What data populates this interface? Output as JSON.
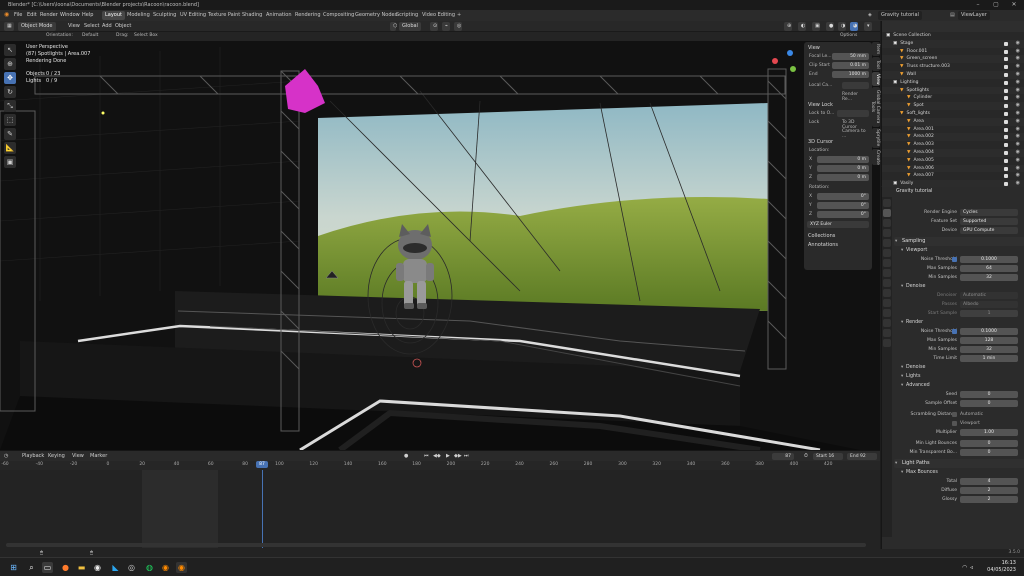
{
  "window": {
    "title": "Blender* [C:\\Users\\loona\\Documents\\Blender projects\\Racoon\\racoon.blend]"
  },
  "menu": {
    "items": [
      "File",
      "Edit",
      "Render",
      "Window",
      "Help"
    ],
    "workspaces": [
      "Layout",
      "Modeling",
      "Sculpting",
      "UV Editing",
      "Texture Paint",
      "Shading",
      "Animation",
      "Rendering",
      "Compositing",
      "Geometry Nodes",
      "Scripting",
      "Video Editing"
    ],
    "active_workspace": "Layout",
    "scene": "Gravity tutorial",
    "view_layer": "ViewLayer"
  },
  "viewport_header": {
    "mode": "Object Mode",
    "menus": [
      "View",
      "Select",
      "Add",
      "Object"
    ],
    "transform": "Global",
    "orientation_label": "Orientation:",
    "orientation_value": "Default",
    "drag_label": "Drag:",
    "drag_value": "Select Box",
    "options": "Options"
  },
  "viewport_overlay": {
    "perspective": "User Perspective",
    "collection": "(87) Spotlights | Area.007",
    "status": "Rendering Done",
    "objects_label": "Objects",
    "objects_value": "0 / 23",
    "lights_label": "Lights",
    "lights_value": "0 / 9"
  },
  "npanel": {
    "view_header": "View",
    "focal_label": "Focal Le...",
    "focal_value": "50 mm",
    "clip_start_label": "Clip Start",
    "clip_start_value": "0.01 m",
    "clip_end_label": "End",
    "clip_end_value": "1000 m",
    "local_camera_label": "Local Ca...",
    "render_region": "Render Re...",
    "view_lock_header": "View Lock",
    "lock_to_label": "Lock to O...",
    "lock_label": "Lock",
    "to_3d_cursor": "To 3D Cursor",
    "camera_to": "Camera to ...",
    "cursor_header": "3D Cursor",
    "location_label": "Location:",
    "loc_x": "0 m",
    "loc_y": "0 m",
    "loc_z": "0 m",
    "rotation_label": "Rotation:",
    "rot_x": "0°",
    "rot_y": "0°",
    "rot_z": "0°",
    "rotation_mode": "XYZ Euler",
    "collections": "Collections",
    "annotations": "Annotations",
    "axis_x": "X",
    "axis_y": "Y",
    "axis_z": "Z",
    "tabs": [
      "Item",
      "Tool",
      "View",
      "Global Camera Tools",
      "Sprytile",
      "Create"
    ]
  },
  "outliner": {
    "rows": [
      {
        "label": "Scene Collection",
        "indent": 0
      },
      {
        "label": "Stage",
        "indent": 1
      },
      {
        "label": "Floor.001",
        "indent": 2
      },
      {
        "label": "Green_screen",
        "indent": 2
      },
      {
        "label": "Truss structure.003",
        "indent": 2
      },
      {
        "label": "Wall",
        "indent": 2
      },
      {
        "label": "Lighting",
        "indent": 1
      },
      {
        "label": "Spotlights",
        "indent": 2
      },
      {
        "label": "Cylinder",
        "indent": 3
      },
      {
        "label": "Spot",
        "indent": 3
      },
      {
        "label": "Soft_lights",
        "indent": 2
      },
      {
        "label": "Area",
        "indent": 3
      },
      {
        "label": "Area.001",
        "indent": 3
      },
      {
        "label": "Area.002",
        "indent": 3
      },
      {
        "label": "Area.003",
        "indent": 3
      },
      {
        "label": "Area.004",
        "indent": 3
      },
      {
        "label": "Area.005",
        "indent": 3
      },
      {
        "label": "Area.006",
        "indent": 3
      },
      {
        "label": "Area.007",
        "indent": 3
      },
      {
        "label": "Vasily",
        "indent": 1
      }
    ]
  },
  "properties": {
    "context": "Gravity tutorial",
    "render_engine_label": "Render Engine",
    "render_engine": "Cycles",
    "feature_set_label": "Feature Set",
    "feature_set": "Supported",
    "device_label": "Device",
    "device": "GPU Compute",
    "sampling": "Sampling",
    "viewport": "Viewport",
    "noise_threshold_label": "Noise Threshold",
    "vp_noise_threshold": "0.1000",
    "max_samples_label": "Max Samples",
    "vp_max_samples": "64",
    "min_samples_label": "Min Samples",
    "vp_min_samples": "32",
    "denoise": "Denoise",
    "denoiser_label": "Denoiser",
    "denoiser": "Automatic",
    "passes_label": "Passes",
    "passes": "Albedo",
    "start_sample_label": "Start Sample",
    "start_sample": "1",
    "render": "Render",
    "r_noise_threshold": "0.1000",
    "r_max_samples": "128",
    "r_min_samples": "32",
    "time_limit_label": "Time Limit",
    "time_limit": "1 min",
    "denoise2": "Denoise",
    "lights": "Lights",
    "advanced": "Advanced",
    "seed_label": "Seed",
    "seed": "0",
    "sample_offset_label": "Sample Offset",
    "sample_offset": "0",
    "scrambling_label": "Scrambling Distance",
    "automatic": "Automatic",
    "viewport_cb": "Viewport",
    "multiplier_label": "Multiplier",
    "multiplier": "1.00",
    "min_light_bounces_label": "Min Light Bounces",
    "min_light_bounces": "0",
    "min_transparent_label": "Min Transparent Bo...",
    "min_transparent": "0",
    "light_paths": "Light Paths",
    "max_bounces": "Max Bounces",
    "total_label": "Total",
    "total": "4",
    "diffuse_label": "Diffuse",
    "diffuse": "2",
    "glossy_label": "Glossy",
    "glossy": "2"
  },
  "timeline": {
    "menus": [
      "Playback",
      "Keying",
      "View",
      "Marker"
    ],
    "current_frame": "87",
    "start_label": "Start",
    "start": "16",
    "end_label": "End",
    "end": "92",
    "ticks": [
      "-60",
      "-40",
      "-20",
      "0",
      "20",
      "40",
      "60",
      "80",
      "100",
      "120",
      "140",
      "160",
      "180",
      "200",
      "220",
      "240",
      "260",
      "280",
      "300",
      "320",
      "340",
      "360",
      "380",
      "400",
      "420"
    ],
    "playhead_label": "87"
  },
  "statusbar": {
    "version": "3.5.0"
  },
  "taskbar": {
    "time": "16:13",
    "date": "04/05/2023"
  }
}
